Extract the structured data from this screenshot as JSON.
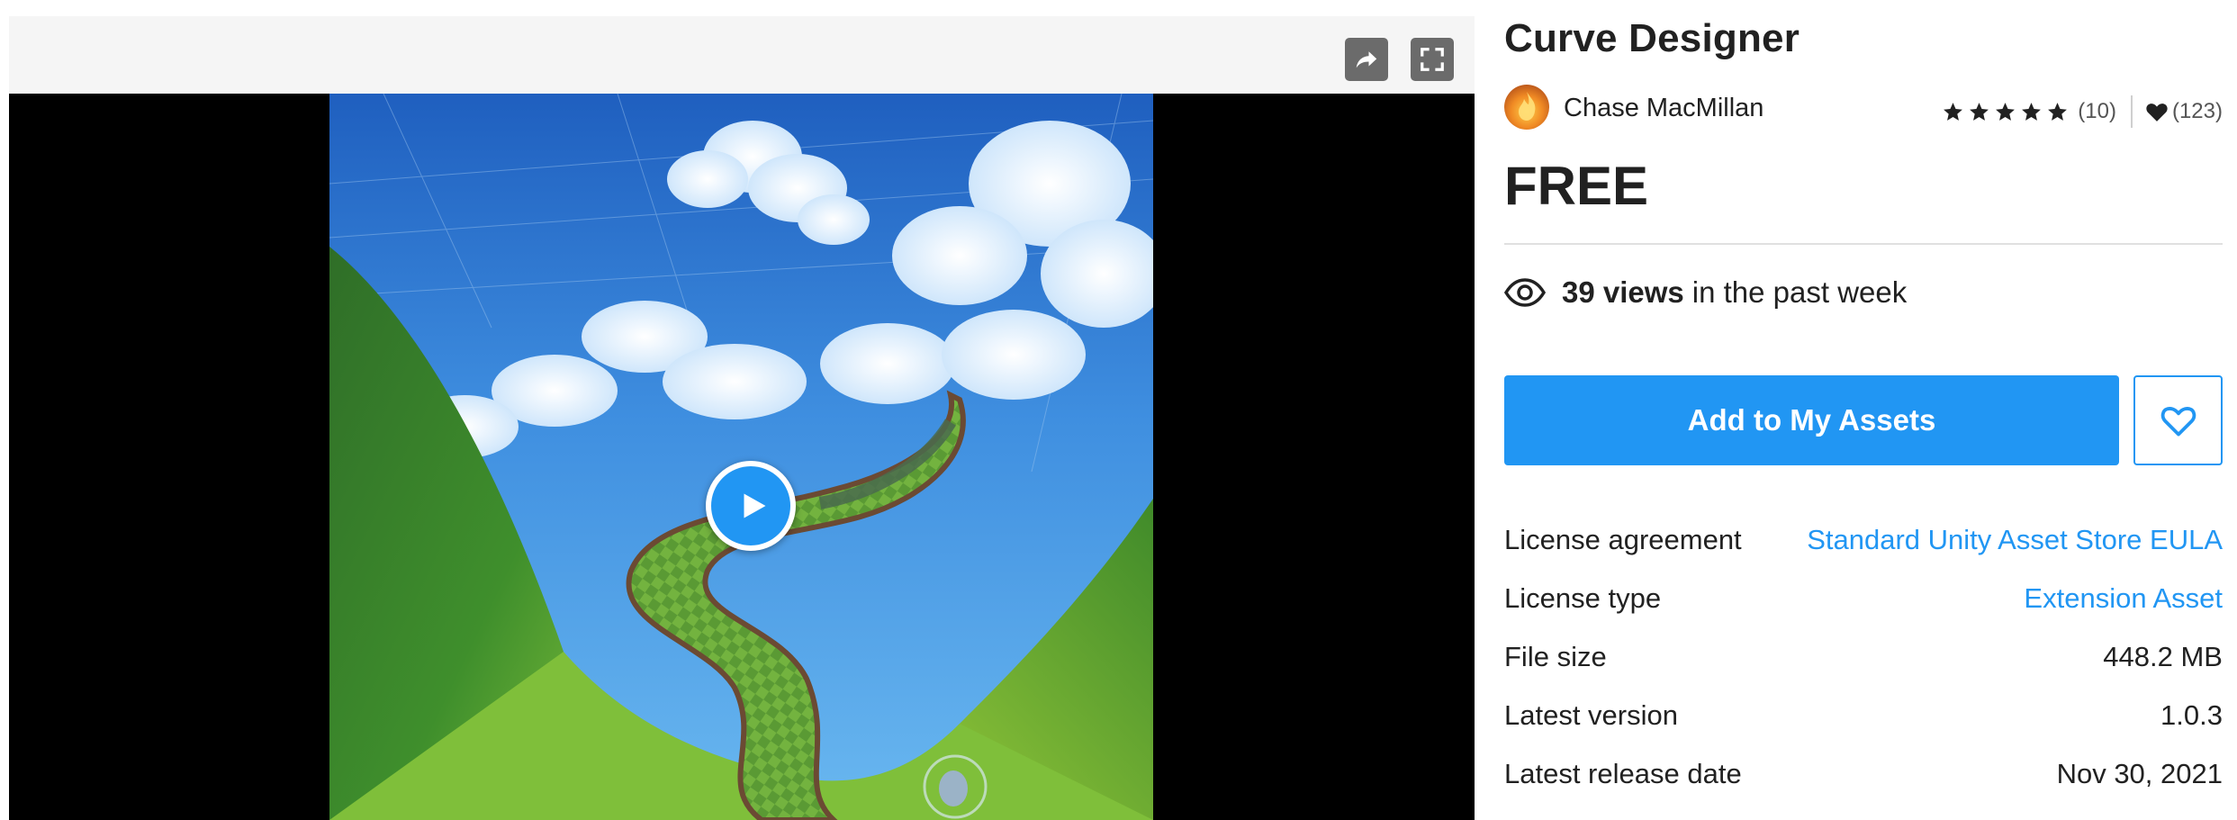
{
  "toolbar": {
    "share_icon": "share-arrow-icon",
    "fullscreen_icon": "fullscreen-icon"
  },
  "media": {
    "play_icon": "play-icon"
  },
  "asset": {
    "title": "Curve Designer",
    "publisher": "Chase MacMillan",
    "rating_stars": 5,
    "rating_count": "(10)",
    "favorites_count": "(123)",
    "price": "FREE"
  },
  "views": {
    "count": "39 views",
    "suffix": "in the past week"
  },
  "actions": {
    "add_label": "Add to My Assets",
    "favorite_icon": "heart-outline-icon"
  },
  "details": [
    {
      "label": "License agreement",
      "value": "Standard Unity Asset Store EULA",
      "link": true
    },
    {
      "label": "License type",
      "value": "Extension Asset",
      "link": true
    },
    {
      "label": "File size",
      "value": "448.2 MB",
      "link": false
    },
    {
      "label": "Latest version",
      "value": "1.0.3",
      "link": false
    },
    {
      "label": "Latest release date",
      "value": "Nov 30, 2021",
      "link": false
    }
  ],
  "colors": {
    "accent": "#2196f3",
    "text": "#212121",
    "toolbar_bg": "#f5f5f5",
    "toolbar_button": "#6b6b6b"
  }
}
